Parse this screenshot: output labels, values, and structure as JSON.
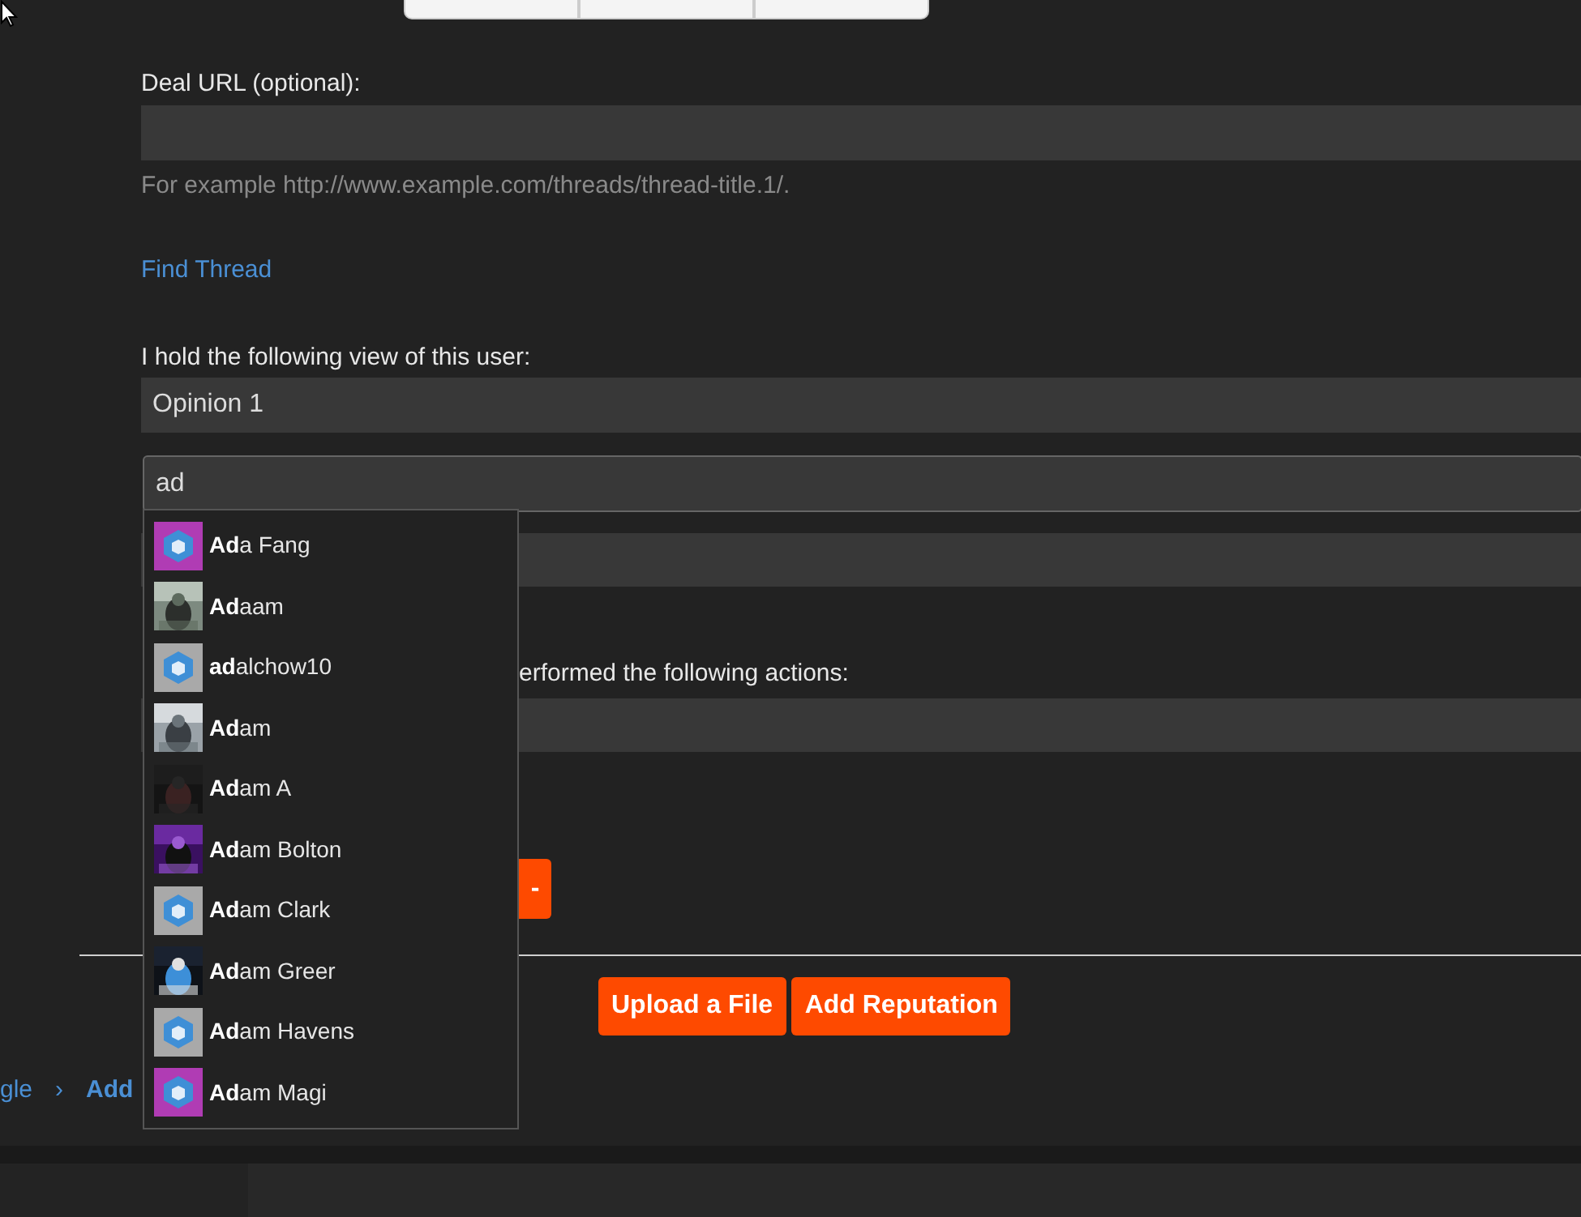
{
  "deal_url": {
    "label": "Deal URL (optional):",
    "hint": "For example http://www.example.com/threads/thread-title.1/."
  },
  "find_thread_link": "Find Thread",
  "view": {
    "label": "I hold the following view of this user:",
    "value": "Opinion 1"
  },
  "user_search": {
    "value": "ad",
    "suggestions": [
      {
        "name": "**Ad**a Fang",
        "kind": "cube",
        "color": "#b03cb4"
      },
      {
        "name": "**Ad**aam",
        "kind": "picture"
      },
      {
        "name": "**ad**alchow10",
        "kind": "cube",
        "color": "#a9a9a9"
      },
      {
        "name": "**Ad**am",
        "kind": "picture"
      },
      {
        "name": "**Ad**am A",
        "kind": "picture"
      },
      {
        "name": "**Ad**am Bolton",
        "kind": "picture"
      },
      {
        "name": "**Ad**am Clark",
        "kind": "cube",
        "color": "#a9a9a9"
      },
      {
        "name": "**Ad**am Greer",
        "kind": "picture"
      },
      {
        "name": "**Ad**am Havens",
        "kind": "cube",
        "color": "#a9a9a9"
      },
      {
        "name": "**Ad**am Magi",
        "kind": "cube",
        "color": "#b03cb4"
      }
    ]
  },
  "actions": {
    "label": "erformed the following actions:"
  },
  "remove_button": "-",
  "buttons": [
    "Upload a File",
    "Add Reputation"
  ],
  "breadcrumb": {
    "separator": "›",
    "items": [
      {
        "label": "gle",
        "current": false
      },
      {
        "label": "Add",
        "current": true
      }
    ]
  }
}
